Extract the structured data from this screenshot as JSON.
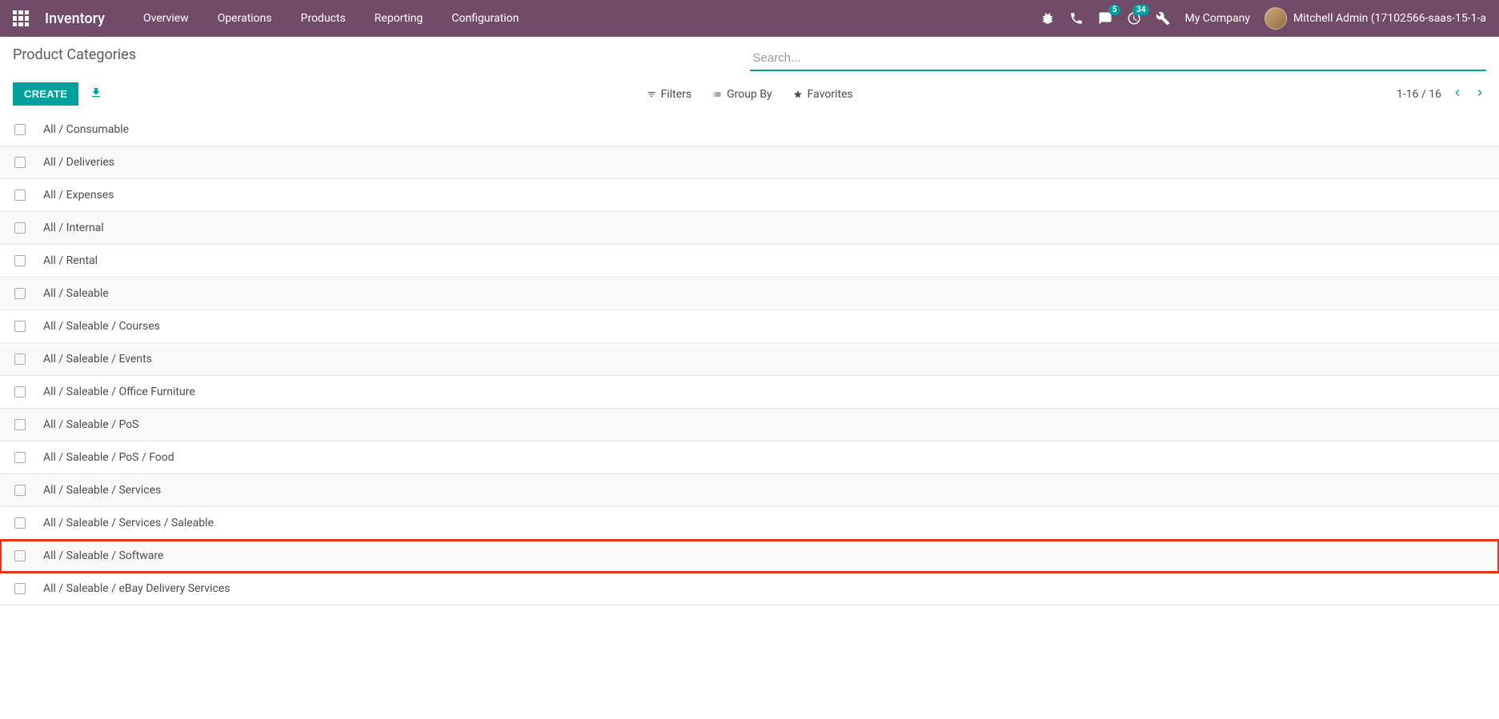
{
  "navbar": {
    "brand": "Inventory",
    "menus": [
      "Overview",
      "Operations",
      "Products",
      "Reporting",
      "Configuration"
    ],
    "msg_badge": "5",
    "activity_badge": "34",
    "company": "My Company",
    "user": "Mitchell Admin (17102566-saas-15-1-a"
  },
  "cp": {
    "title": "Product Categories",
    "create": "CREATE",
    "search_ph": "Search...",
    "filters": "Filters",
    "groupby": "Group By",
    "favorites": "Favorites",
    "pager": "1-16 / 16"
  },
  "rows": [
    "All / Consumable",
    "All / Deliveries",
    "All / Expenses",
    "All / Internal",
    "All / Rental",
    "All / Saleable",
    "All / Saleable / Courses",
    "All / Saleable / Events",
    "All / Saleable / Office Furniture",
    "All / Saleable / PoS",
    "All / Saleable / PoS / Food",
    "All / Saleable / Services",
    "All / Saleable / Services / Saleable",
    "All / Saleable / Software",
    "All / Saleable / eBay Delivery Services"
  ],
  "highlighted_index": 13
}
